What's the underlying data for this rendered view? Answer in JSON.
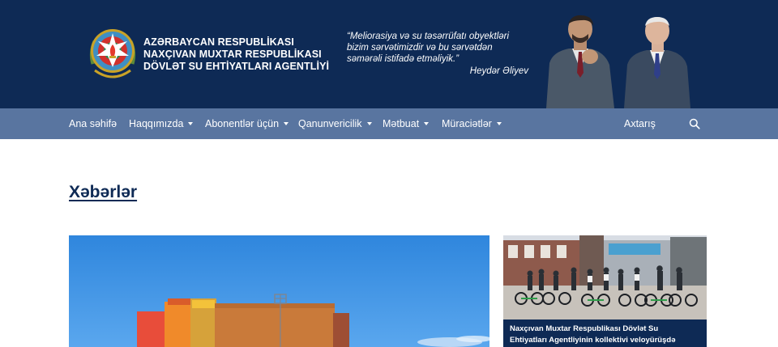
{
  "header": {
    "agency_name": [
      "AZƏRBAYCAN RESPUBLİKASI",
      "NAXÇIVAN MUXTAR RESPUBLİKASI",
      "DÖVLƏT SU EHTİYATLARI AGENTLİYİ"
    ],
    "quote_lines": [
      "“Meliorasiya və su təsərrüfatı obyektləri",
      "bizim sərvətimizdir və bu sərvətdən",
      "səmərəli istifadə etməliyik.”"
    ],
    "quote_author": "Heydər Əliyev",
    "colors": {
      "background": "#0e2a55",
      "text": "#ffffff"
    }
  },
  "nav": {
    "items": [
      {
        "label": "Ana səhifə",
        "has_dropdown": false
      },
      {
        "label": "Haqqımızda",
        "has_dropdown": true
      },
      {
        "label": "Abonentlər üçün",
        "has_dropdown": true
      },
      {
        "label": "Qanunvericilik",
        "has_dropdown": true
      },
      {
        "label": "Mətbuat",
        "has_dropdown": true
      },
      {
        "label": "Müraciətlər",
        "has_dropdown": true
      }
    ],
    "search_label": "Axtarış",
    "search_icon": "search-icon",
    "colors": {
      "background": "#5975a0",
      "text": "#ffffff"
    }
  },
  "content": {
    "section_title": "Xəbərlər",
    "side_news": {
      "caption_lines": [
        "Naxçıvan Muxtar Respublikası Dövlət Su",
        "Ehtiyatları Agentliyinin kollektivi veloyürüşdə"
      ]
    }
  }
}
